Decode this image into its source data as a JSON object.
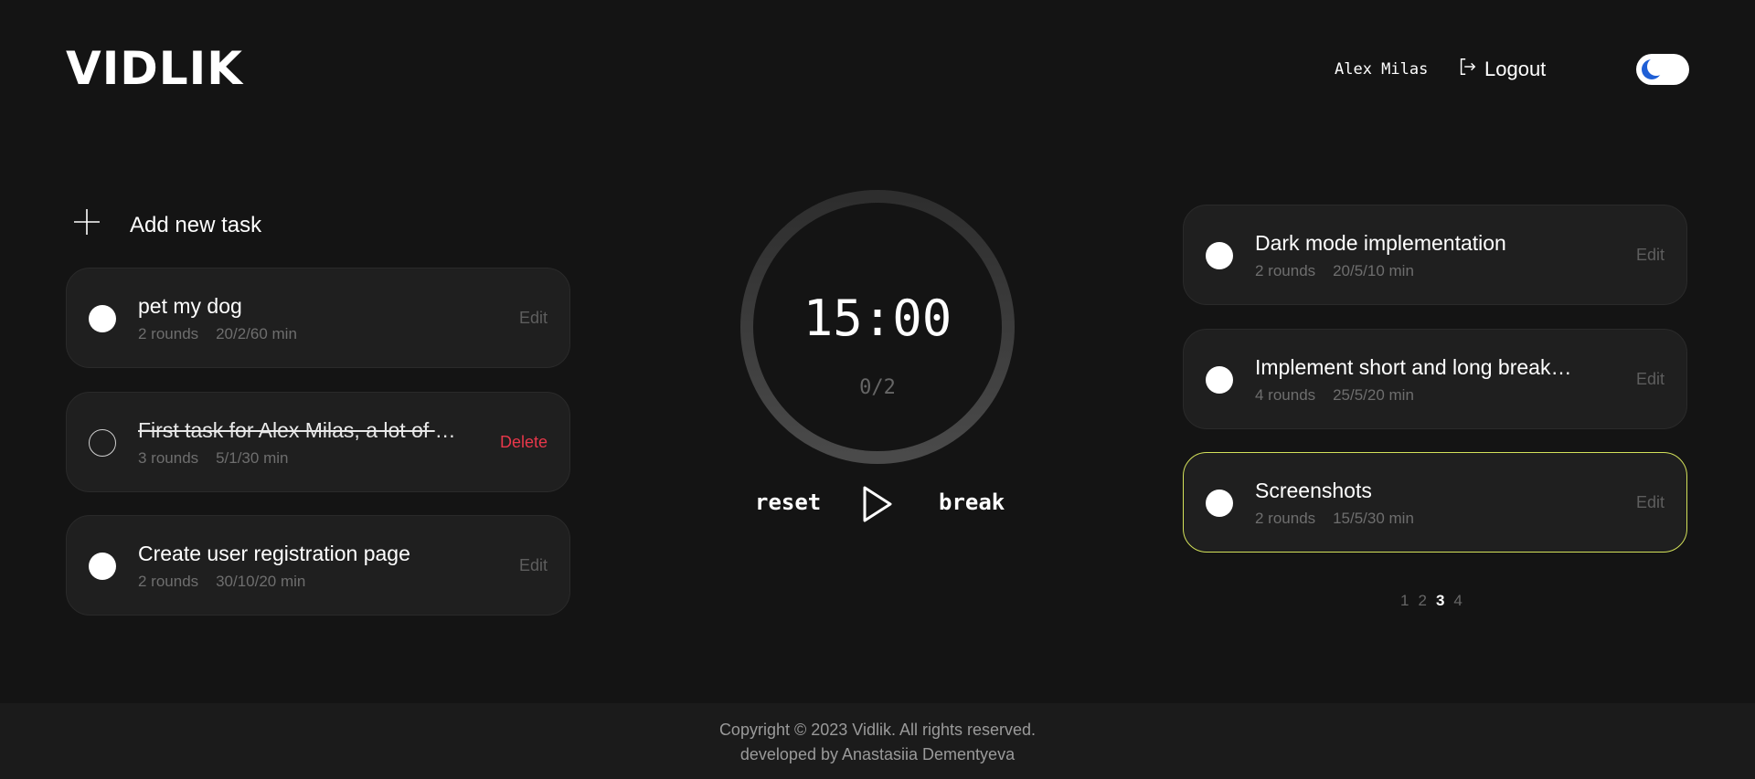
{
  "header": {
    "logo": "VIDLIK",
    "user_name": "Alex Milas",
    "logout_label": "Logout"
  },
  "left": {
    "add_task_label": "Add new task",
    "tasks": [
      {
        "title": "pet my dog",
        "rounds": "2 rounds",
        "times": "20/2/60 min",
        "action": "Edit",
        "done": false
      },
      {
        "title": "First task for Alex Milas, a lot of text here",
        "rounds": "3 rounds",
        "times": "5/1/30 min",
        "action": "Delete",
        "done": true
      },
      {
        "title": "Create user registration page",
        "rounds": "2 rounds",
        "times": "30/10/20 min",
        "action": "Edit",
        "done": false
      }
    ]
  },
  "timer": {
    "time": "15:00",
    "rounds": "0/2",
    "reset_label": "reset",
    "break_label": "break"
  },
  "right": {
    "tasks": [
      {
        "title": "Dark mode implementation",
        "rounds": "2 rounds",
        "times": "20/5/10 min",
        "action": "Edit"
      },
      {
        "title": "Implement short and long break timers",
        "rounds": "4 rounds",
        "times": "25/5/20 min",
        "action": "Edit"
      },
      {
        "title": "Screenshots",
        "rounds": "2 rounds",
        "times": "15/5/30 min",
        "action": "Edit",
        "active": true
      }
    ],
    "pages": [
      "1",
      "2",
      "3",
      "4"
    ],
    "current_page": "3"
  },
  "footer": {
    "copyright": "Copyright © 2023 Vidlik. All rights reserved.",
    "credit": "developed by Anastasiia Dementyeva"
  },
  "colors": {
    "background": "#141414",
    "card": "#1f1f1f",
    "active_border": "#d4e25a",
    "delete": "#e8374a",
    "toggle_moon": "#1f5fd6"
  },
  "icons": [
    "logout-icon",
    "moon-icon",
    "plus-icon",
    "play-icon"
  ]
}
